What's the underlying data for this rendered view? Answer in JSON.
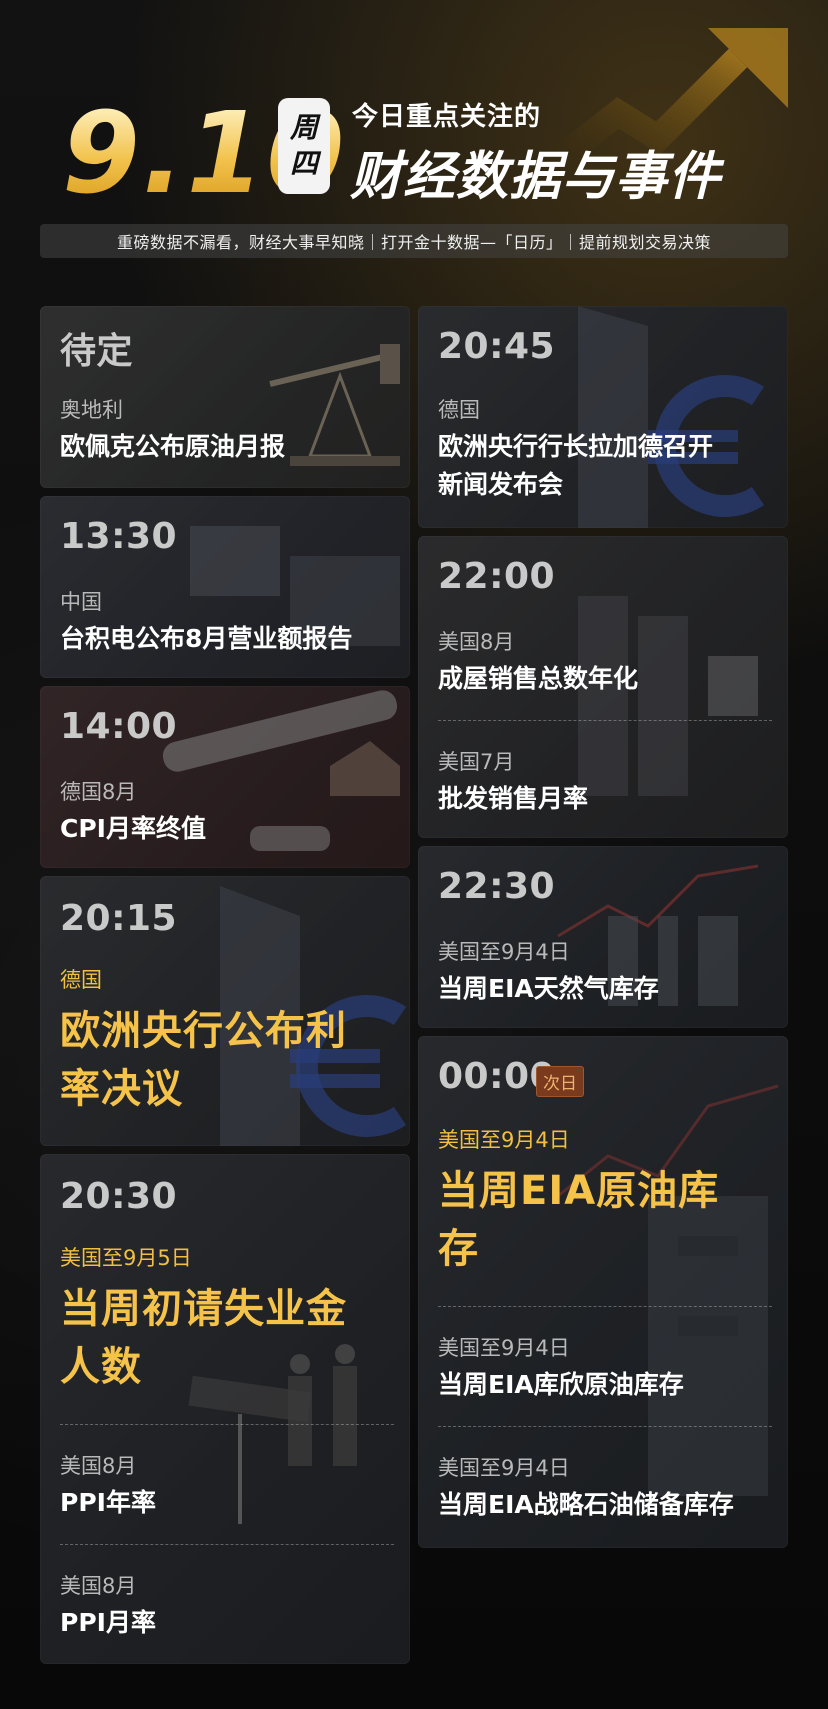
{
  "header": {
    "date": "9.10",
    "weekday_1": "周",
    "weekday_2": "四",
    "title_small": "今日重点关注的",
    "title_large": "财经数据与事件",
    "subtitle": "重磅数据不漏看，财经大事早知晓｜打开金十数据—「日历」｜提前规划交易决策"
  },
  "colors": {
    "accent_gold": "#f5c24a",
    "card_bg": "#1c1c1f",
    "badge_bg": "#7a3a1e"
  },
  "left_cards": [
    {
      "time": "待定",
      "region": "奥地利",
      "event": "欧佩克公布原油月报"
    },
    {
      "time": "13:30",
      "region": "中国",
      "event": "台积电公布8月营业额报告"
    },
    {
      "time": "14:00",
      "region": "德国8月",
      "event": "CPI月率终值"
    },
    {
      "time": "20:15",
      "region": "德国",
      "event_line1": "欧洲央行公布利",
      "event_line2": "率决议"
    },
    {
      "time": "20:30",
      "region": "美国至9月5日",
      "event_line1": "当周初请失业金",
      "event_line2": "人数",
      "sub1_region": "美国8月",
      "sub1_event": "PPI年率",
      "sub2_region": "美国8月",
      "sub2_event": "PPI月率"
    }
  ],
  "right_cards": [
    {
      "time": "20:45",
      "region": "德国",
      "event_line1": "欧洲央行行长拉加德召开",
      "event_line2": "新闻发布会"
    },
    {
      "time": "22:00",
      "region": "美国8月",
      "event": "成屋销售总数年化",
      "sub1_region": "美国7月",
      "sub1_event": "批发销售月率"
    },
    {
      "time": "22:30",
      "region": "美国至9月4日",
      "event": "当周EIA天然气库存"
    },
    {
      "time": "00:00",
      "badge": "次日",
      "region": "美国至9月4日",
      "event_line1": "当周EIA原油库",
      "event_line2": "存",
      "sub1_region": "美国至9月4日",
      "sub1_event": "当周EIA库欣原油库存",
      "sub2_region": "美国至9月4日",
      "sub2_event": "当周EIA战略石油储备库存"
    }
  ],
  "icons": [
    "trend-arrow-icon"
  ]
}
